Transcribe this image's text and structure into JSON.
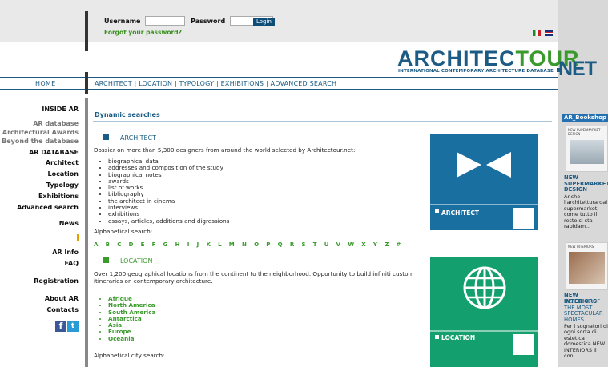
{
  "login": {
    "username_label": "Username",
    "password_label": "Password",
    "login_button": "Login",
    "forgot": "Forgot your password?"
  },
  "logo": {
    "main_blue": "ARCHITEC",
    "main_green": "TOUR",
    "net": "NET",
    "subtitle": "INTERNATIONAL CONTEMPORARY ARCHITECTURE DATABASE"
  },
  "nav": {
    "home": "HOME",
    "links": "ARCHITECT | LOCATION | TYPOLOGY | EXHIBITIONS | ADVANCED SEARCH"
  },
  "sidebar": {
    "inside_ar": "INSIDE AR",
    "ar_database": "AR database",
    "architectural_awards": "Architectural Awards",
    "beyond": "Beyond the database",
    "ar_database_upper": "AR DATABASE",
    "architect": "Architect",
    "location": "Location",
    "typology": "Typology",
    "exhibitions": "Exhibitions",
    "advanced_search": "Advanced search",
    "news": "News",
    "ar_info": "AR Info",
    "faq": "FAQ",
    "registration": "Registration",
    "about_ar": "About AR",
    "contacts": "Contacts",
    "facebook_glyph": "f",
    "twitter_glyph": "t"
  },
  "main": {
    "dynamic_title": "Dynamic searches",
    "architect": {
      "title": "ARCHITECT",
      "description": "Dossier on more than 5,300 designers from around the world selected by Architectour.net:",
      "bullets": [
        "biographical data",
        "addresses and composition of the study",
        "biographical notes",
        "awards",
        "list of works",
        "bibliography",
        "the architect in cinema",
        "interviews",
        "exhibitions",
        "essays, articles, additions and digressions"
      ],
      "alpha_label": "Alphabetical search:",
      "alpha_letters": "A B C D E F G H I J K L M N O P Q R S T U V W X Y Z #",
      "icon_label": "ARCHITECT"
    },
    "location": {
      "title": "LOCATION",
      "description": "Over 1,200 geographical locations from the continent to the neighborhood. Opportunity to build infiniti custom itineraries on contemporary architecture.",
      "continents": [
        "Afrique",
        "North America",
        "South America",
        "Antarctica",
        "Asia",
        "Europe",
        "Oceania"
      ],
      "alpha_label": "Alphabetical city search:",
      "icon_label": "LOCATION"
    }
  },
  "bookshop": {
    "header": "AR_Bookshop",
    "item1": {
      "cover_text": "NEW SUPERMARKET DESIGN",
      "title": "NEW SUPERMARKET DESIGN",
      "text": "Anche l'architettura dal supermarket, come tutto il resto si sta rapidam..."
    },
    "item2": {
      "cover_text": "NEW INTERIORS",
      "title": "NEW INTERIORS",
      "subtitle": "INSIDE 40 OF THE MOST SPECTACULAR HOMES",
      "text": "Per i sognatori di ogni sorta di estetica domestica NEW INTERIORS il con..."
    }
  },
  "colors": {
    "brand_blue": "#1c5c84",
    "brand_green": "#3a9a2c",
    "architect_tile": "#1a6fa1",
    "location_tile": "#13a06e"
  }
}
